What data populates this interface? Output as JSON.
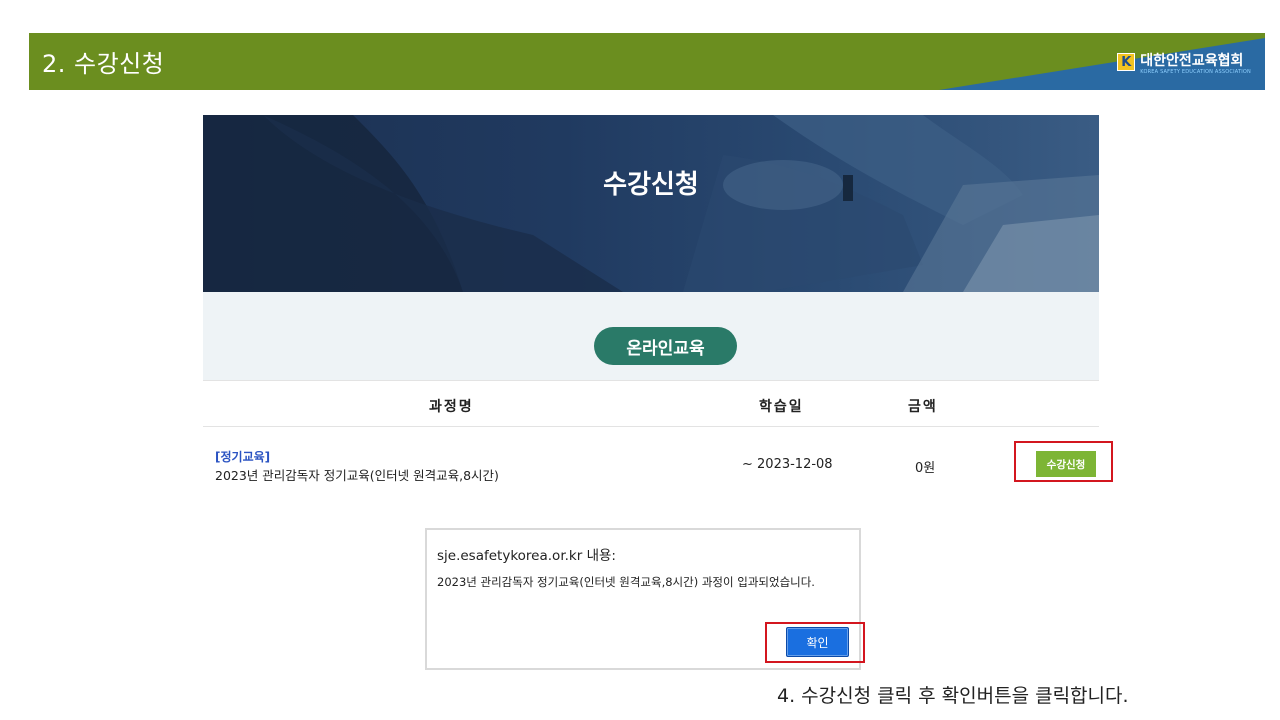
{
  "header": {
    "title": "2. 수강신청",
    "logo_mark": "K",
    "logo_name": "대한안전교육협회",
    "logo_sub": "KOREA SAFETY EDUCATION ASSOCIATION",
    "colors": {
      "bar": "#6b8e1f",
      "wedge": "#2a6aa3"
    }
  },
  "banner": {
    "title": "수강신청"
  },
  "category_pill": "온라인교육",
  "table": {
    "headers": [
      "과정명",
      "학습일",
      "금액"
    ],
    "rows": [
      {
        "category": "[정기교육]",
        "name": "2023년 관리감독자 정기교육(인터넷 원격교육,8시간)",
        "date": "~ 2023-12-08",
        "price": "0원",
        "button": "수강신청"
      }
    ]
  },
  "dialog": {
    "title": "sje.esafetykorea.or.kr 내용:",
    "message": "2023년 관리감독자 정기교육(인터넷 원격교육,8시간) 과정이 입과되었습니다.",
    "ok_label": "확인"
  },
  "footnote": "4. 수강신청 클릭 후 확인버튼을 클릭합니다.",
  "accent_colors": {
    "enroll_button": "#7db535",
    "highlight": "#d3161f",
    "ok_button": "#1a6fe0",
    "pill": "#2a7a68"
  }
}
